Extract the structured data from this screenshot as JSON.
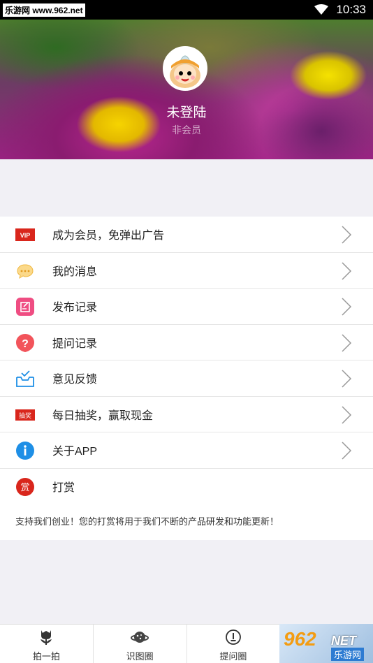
{
  "status_bar": {
    "watermark": "乐游网 www.962.net",
    "time": "10:33"
  },
  "header": {
    "username": "未登陆",
    "membership": "非会员"
  },
  "menu": {
    "items": [
      {
        "icon": "vip-icon",
        "icon_text": "VIP",
        "label": "成为会员，免弹出广告",
        "has_chevron": true
      },
      {
        "icon": "message-icon",
        "label": "我的消息",
        "has_chevron": true
      },
      {
        "icon": "publish-record-icon",
        "label": "发布记录",
        "has_chevron": true
      },
      {
        "icon": "question-icon",
        "label": "提问记录",
        "has_chevron": true
      },
      {
        "icon": "feedback-icon",
        "label": "意见反馈",
        "has_chevron": true
      },
      {
        "icon": "lottery-icon",
        "icon_text": "抽奖",
        "label": "每日抽奖，赢取现金",
        "has_chevron": true
      },
      {
        "icon": "info-icon",
        "label": "关于APP",
        "has_chevron": true
      },
      {
        "icon": "reward-icon",
        "icon_text": "赏",
        "label": "打赏",
        "has_chevron": false
      }
    ],
    "note": "支持我们创业！您的打赏将用于我们不断的产品研发和功能更新！"
  },
  "tabbar": {
    "tabs": [
      {
        "label": "拍一拍",
        "icon": "tulip-icon"
      },
      {
        "label": "识图圈",
        "icon": "planet-icon"
      },
      {
        "label": "提问圈",
        "icon": "ask-icon"
      }
    ],
    "promo": {
      "big": "962",
      "net": "NET",
      "cn": "乐游网"
    }
  },
  "colors": {
    "accent_red": "#d9261c",
    "pink": "#ef4d82",
    "blue": "#1e8fe6",
    "page_bg": "#f1f0f5"
  }
}
